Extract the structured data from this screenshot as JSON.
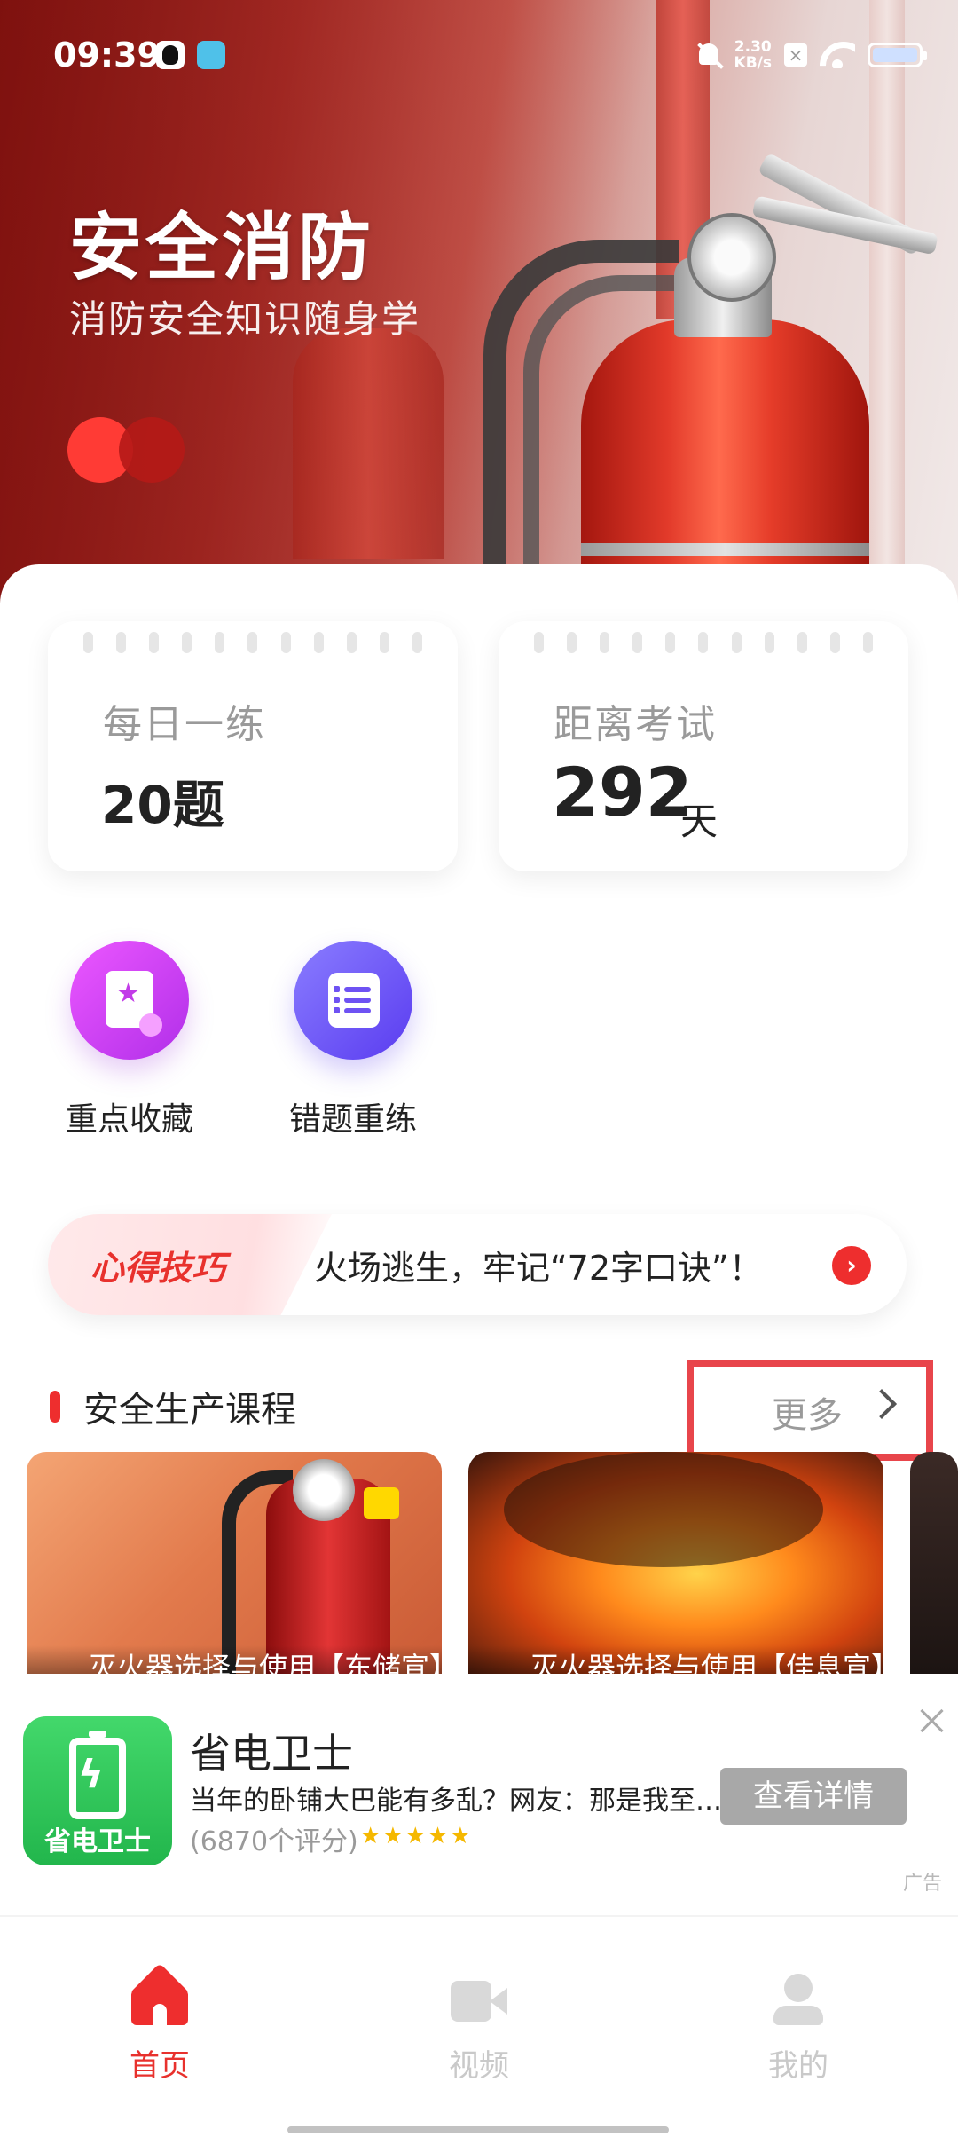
{
  "status_bar": {
    "time": "09:39",
    "network_speed_value": "2.30",
    "network_speed_unit": "KB/s",
    "icons": [
      "qq-icon",
      "app-notification-icon",
      "mute-icon",
      "no-sim-icon",
      "wifi-icon",
      "battery-icon"
    ]
  },
  "hero": {
    "title": "安全消防",
    "subtitle": "消防安全知识随身学"
  },
  "stats": {
    "daily": {
      "label": "每日一练",
      "value": "20题"
    },
    "exam": {
      "label": "距离考试",
      "value": "292",
      "unit": "天"
    }
  },
  "quick_actions": [
    {
      "label": "重点收藏",
      "icon": "bookmark-star-icon"
    },
    {
      "label": "错题重练",
      "icon": "list-notebook-icon"
    }
  ],
  "tip": {
    "tag": "心得技巧",
    "text": "火场逃生，牢记“72字口诀”！"
  },
  "courses": {
    "section_title": "安全生产课程",
    "more_label": "更多",
    "items": [
      {
        "caption": "灭火器选择与使用【东储宣】"
      },
      {
        "caption": "灭火器选择与使用【佳息宣】"
      }
    ]
  },
  "ad": {
    "title": "省电卫士",
    "icon_label": "省电卫士",
    "description": "当年的卧铺大巴能有多乱？网友：那是我至…",
    "rating": "(6870个评分)",
    "stars": "★★★★★",
    "cta": "查看详情",
    "tag": "广告"
  },
  "tabbar": {
    "items": [
      {
        "label": "首页",
        "active": true
      },
      {
        "label": "视频",
        "active": false
      },
      {
        "label": "我的",
        "active": false
      }
    ]
  },
  "colors": {
    "accent": "#ee2e2e",
    "text_primary": "#222222",
    "text_muted": "#9a9a9a",
    "favorite_gradient": [
      "#ec57ff",
      "#b12fe9"
    ],
    "wrongbook_gradient": [
      "#8a7dff",
      "#5a3cf0"
    ],
    "ad_icon_green": "#22b64c"
  }
}
